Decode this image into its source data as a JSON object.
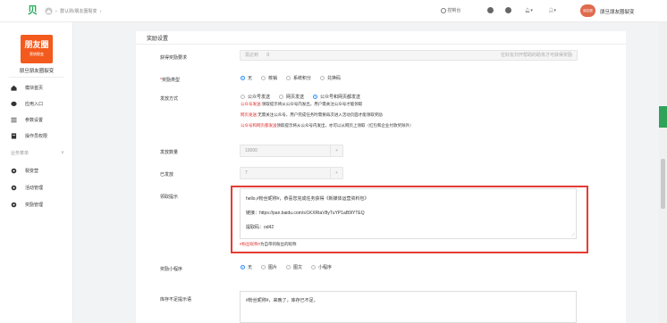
{
  "topbar": {
    "logo_text": "贝",
    "breadcrumb": [
      "›",
      "群认购/朋友圈裂变",
      "›"
    ],
    "items": [
      {
        "icon": "circle-icon",
        "label": "控制台"
      },
      {
        "icon": "help-icon",
        "label": ""
      },
      {
        "icon": "help-icon",
        "label": ""
      },
      {
        "icon": "bell-icon",
        "label": "▾"
      },
      {
        "icon": "user-icon",
        "label": "▾"
      }
    ],
    "avatar_text": "朋友圈",
    "shop_name": "朋旦朋友圈裂变"
  },
  "sidebar": {
    "brand_line1": "朋友圈",
    "brand_line2": "营销裂变",
    "brand_name": "朋旦朋友圈裂变",
    "nav": [
      {
        "icon": "home-icon",
        "label": "模块首页"
      },
      {
        "icon": "chat-icon",
        "label": "应用入口"
      },
      {
        "icon": "list-icon",
        "label": "参数设置"
      },
      {
        "icon": "file-icon",
        "label": "操作员权限"
      }
    ],
    "group_label": "业务菜单",
    "group_arrow": "∨",
    "group_items": [
      {
        "icon": "gear-icon",
        "label": "裂变营"
      },
      {
        "icon": "gear-icon",
        "label": "活动管理"
      },
      {
        "icon": "gear-icon",
        "label": "奖励管理"
      }
    ]
  },
  "form": {
    "section_title": "奖励设置",
    "fields": {
      "reward_req": {
        "label": "获得奖励要求",
        "prefix": "需达到",
        "value": "0",
        "suffix": "位好友扫开帮助的助攻才可获得奖励"
      },
      "reward_type": {
        "label": "奖励类型",
        "required": "*",
        "options": [
          "无",
          "核销",
          "系统积分",
          "兑换码"
        ],
        "selected": 0
      },
      "send_method": {
        "label": "发放方式",
        "options": [
          "公众号发送",
          "网页发送",
          "公众号和网页都发送"
        ],
        "selected": 2
      },
      "notes": [
        {
          "red": "公众号发送:",
          "text": "领取提示将从公众号内发出，用户需关注公众号才能领取"
        },
        {
          "red": "网页发送:",
          "text": "无需关注公众号，用户完成任务时需要再次进入活动页面才能领取奖励"
        },
        {
          "red": "公众号和网页都发送",
          "text": "领取提示将从公众号内发出，亦可以从网页上领取（红包和企业付款奖除外）"
        }
      ],
      "quantity": {
        "label": "发放数量",
        "value": "10000"
      },
      "sent": {
        "label": "已发放",
        "value": "7"
      },
      "claim_tip": {
        "label": "领取提示",
        "lines": [
          "hello,#粉丝昵称#，恭喜您完成任务获得《新媒体运营资料包》",
          "链接：https://pan.baidu.com/s/1KXRtaV8yTuYP1aB9lYTEQ",
          "提取码：od42"
        ],
        "hint_red": "#粉丝昵称#",
        "hint_text": "为自带的粉丝的昵称"
      },
      "reward_applet": {
        "label": "奖励小程序",
        "options": [
          "无",
          "图片",
          "图文",
          "小程序"
        ],
        "selected": 0
      },
      "stock_tip": {
        "label": "库存不足提示语",
        "value": "#粉丝昵称#，来晚了，库存已不足。"
      }
    },
    "stepper_plus": "+"
  },
  "colors": {
    "brand": "#f35a1d",
    "highlight": "#e43c33",
    "radio": "#2f8cf0",
    "side_tab": "#2fa35a"
  }
}
